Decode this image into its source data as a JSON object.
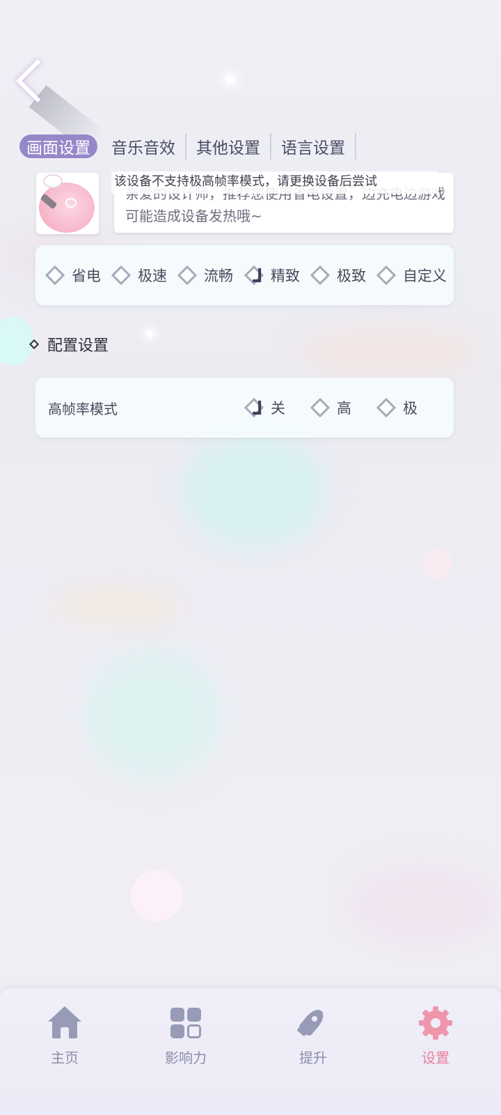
{
  "tabs": [
    {
      "label": "画面设置",
      "active": true
    },
    {
      "label": "音乐音效",
      "active": false
    },
    {
      "label": "其他设置",
      "active": false
    },
    {
      "label": "语言设置",
      "active": false
    }
  ],
  "notice": {
    "text": "亲爱的设计师，推荐您使用省电设置，边充电边游戏可能造成设备发热哦~",
    "toast": "该设备不支持极高帧率模式，请更换设备后尝试"
  },
  "quality_options": [
    {
      "label": "省电",
      "checked": false
    },
    {
      "label": "极速",
      "checked": false
    },
    {
      "label": "流畅",
      "checked": false
    },
    {
      "label": "精致",
      "checked": true
    },
    {
      "label": "极致",
      "checked": false
    },
    {
      "label": "自定义",
      "checked": false
    }
  ],
  "section": {
    "title": "配置设置"
  },
  "fps": {
    "label": "高帧率模式",
    "options": [
      {
        "label": "关",
        "checked": true
      },
      {
        "label": "高",
        "checked": false
      },
      {
        "label": "极",
        "checked": false
      }
    ]
  },
  "nav": [
    {
      "label": "主页",
      "icon": "home-icon",
      "active": false
    },
    {
      "label": "影响力",
      "icon": "grid-icon",
      "active": false
    },
    {
      "label": "提升",
      "icon": "rocket-icon",
      "active": false
    },
    {
      "label": "设置",
      "icon": "gear-icon",
      "active": true
    }
  ],
  "colors": {
    "accent": "#9687c9",
    "nav_active": "#e882a0",
    "nav_inactive": "#8c8faa"
  }
}
